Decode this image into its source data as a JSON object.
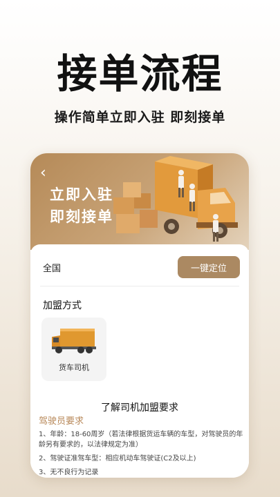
{
  "hero": {
    "title": "接单流程",
    "subtitle": "操作简单立即入驻 即刻接单"
  },
  "banner": {
    "back_icon": "chevron-left-icon",
    "line1": "立即入驻",
    "line2": "即刻接单"
  },
  "location": {
    "region": "全国",
    "locate_button": "一键定位"
  },
  "join": {
    "section_title": "加盟方式",
    "options": [
      {
        "label": "货车司机",
        "icon": "truck-icon"
      }
    ]
  },
  "requirements": {
    "title": "了解司机加盟要求",
    "subtitle": "驾驶员要求",
    "items": [
      "1、年龄：18-60周岁（若法律根据货运车辆的车型，对驾驶员的年龄另有要求的，以法律规定为准）",
      "2、驾驶证准驾车型：相应机动车驾驶证(C2及以上)",
      "3、无不良行为记录"
    ]
  },
  "colors": {
    "accent": "#ab8962",
    "subtitle_accent": "#b8895a"
  }
}
